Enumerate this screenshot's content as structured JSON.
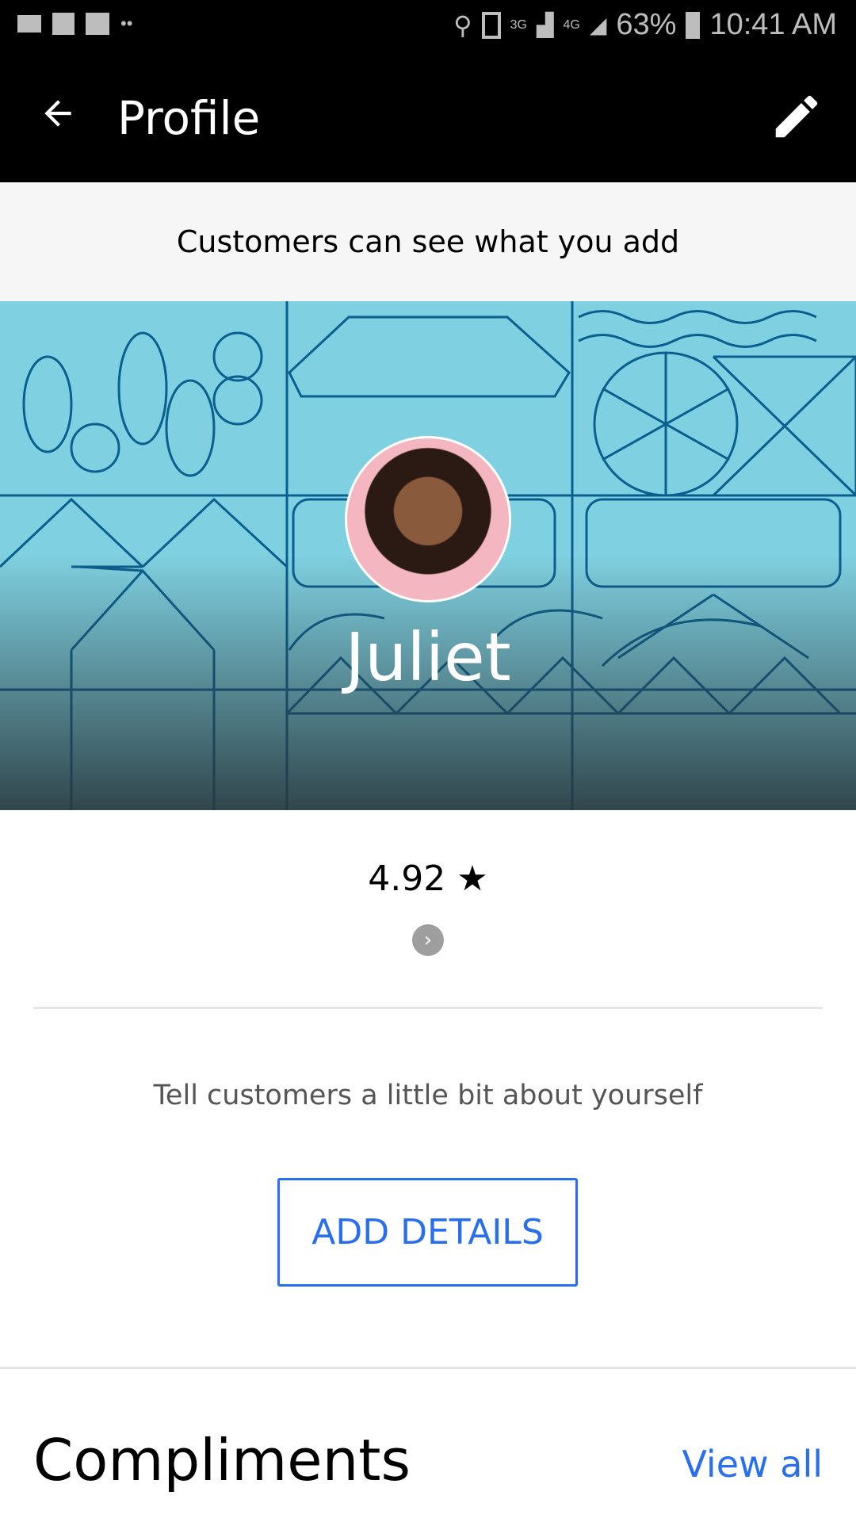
{
  "status_bar": {
    "battery": "63%",
    "time": "10:41 AM",
    "network_1": "3G",
    "network_2": "4G"
  },
  "app_bar": {
    "title": "Profile"
  },
  "banner": {
    "text": "Customers can see what you add"
  },
  "profile": {
    "name": "Juliet",
    "rating": "4.92",
    "rating_icon": "★"
  },
  "about": {
    "prompt": "Tell customers a little bit about yourself",
    "button": "ADD DETAILS"
  },
  "compliments": {
    "heading": "Compliments",
    "view_all": "View all"
  },
  "colors": {
    "accent": "#276ef1",
    "hero_bg": "#7fd0e0",
    "line": "#0a5f8f"
  }
}
